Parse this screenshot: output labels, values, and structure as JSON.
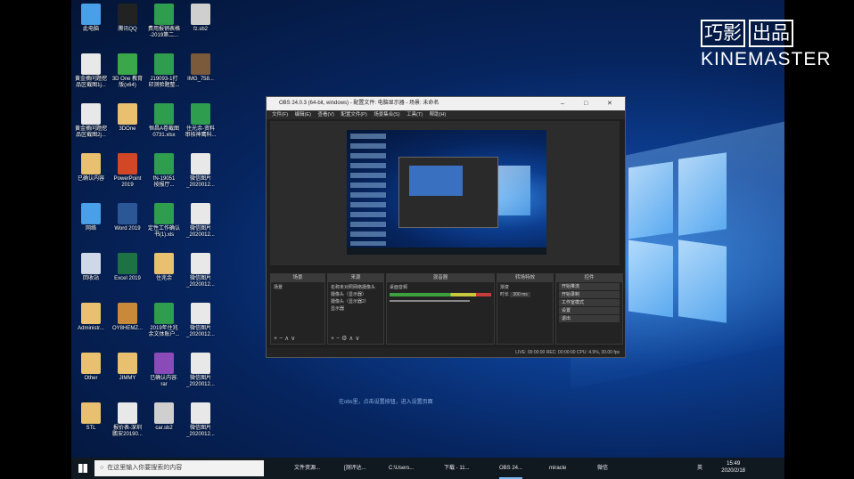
{
  "desktop": {
    "icons": [
      {
        "label": "此电脑",
        "color": "#4aa0e8"
      },
      {
        "label": "腾讯QQ",
        "color": "#222222"
      },
      {
        "label": "费用报销表格\n-2019第二...",
        "color": "#2e9d4e"
      },
      {
        "label": "fz.sb2",
        "color": "#cfcfcf"
      },
      {
        "label": "黄金摘问题挖\n品区截图1j...",
        "color": "#e8e8e8"
      },
      {
        "label": "3D One 教育\n版(x64)",
        "color": "#3aa84a"
      },
      {
        "label": "J19093-1打\n印测验题整...",
        "color": "#2e9d4e"
      },
      {
        "label": "IMG_758...",
        "color": "#7a5a3a"
      },
      {
        "label": "黄金摘问题挖\n品区截图2j...",
        "color": "#e8e8e8"
      },
      {
        "label": "3DOne",
        "color": "#e8c070"
      },
      {
        "label": "恒昌A卷截图\n0731.xlsx",
        "color": "#2e9d4e"
      },
      {
        "label": "住光余-资料\n审核神鹰科...",
        "color": "#2e9d4e"
      },
      {
        "label": "已确认内容",
        "color": "#e8c070"
      },
      {
        "label": "PowerPoint\n2019",
        "color": "#d24726"
      },
      {
        "label": "fN-19051\n按报厅...",
        "color": "#2e9d4e"
      },
      {
        "label": "微信图片\n_2020012...",
        "color": "#e8e8e8"
      },
      {
        "label": "网络",
        "color": "#4aa0e8"
      },
      {
        "label": "Word 2019",
        "color": "#2b5797"
      },
      {
        "label": "定性工作确认\n书(1).xls",
        "color": "#2e9d4e"
      },
      {
        "label": "微信图片\n_2020012...",
        "color": "#e8e8e8"
      },
      {
        "label": "回收站",
        "color": "#cfd8e8"
      },
      {
        "label": "Excel 2019",
        "color": "#1e7145"
      },
      {
        "label": "住兆余",
        "color": "#e8c070"
      },
      {
        "label": "微信图片\n_2020012...",
        "color": "#e8e8e8"
      },
      {
        "label": "Administr...",
        "color": "#e8c070"
      },
      {
        "label": "OY8HEMZ...",
        "color": "#c88a3a"
      },
      {
        "label": "2019年住兆\n余文体账户...",
        "color": "#2e9d4e"
      },
      {
        "label": "微信图片\n_2020012...",
        "color": "#e8e8e8"
      },
      {
        "label": "Other",
        "color": "#e8c070"
      },
      {
        "label": "JIMMY",
        "color": "#e8c070"
      },
      {
        "label": "已确认内容.\nrar",
        "color": "#8a4ab8"
      },
      {
        "label": "微信图片\n_2020012...",
        "color": "#e8e8e8"
      },
      {
        "label": "STL",
        "color": "#e8c070"
      },
      {
        "label": "报价表-深圳\n鹏安20190...",
        "color": "#e8e8e8"
      },
      {
        "label": "car.sb2",
        "color": "#cfcfcf"
      },
      {
        "label": "微信图片\n_2020012...",
        "color": "#e8e8e8"
      }
    ]
  },
  "obs": {
    "title": "OBS 24.0.3 (64-bit, windows) - 配置文件: 电脑显示器 - 场景: 未命名",
    "menu": [
      "文件(F)",
      "编辑(E)",
      "查看(V)",
      "配置文件(P)",
      "场景集合(S)",
      "工具(T)",
      "帮助(H)"
    ],
    "docks": {
      "scenes": {
        "header": "场景",
        "items": [
          "场景"
        ]
      },
      "sources": {
        "header": "来源",
        "items": [
          "名称未对照网络摄像头",
          "摄像头（显示器）",
          "摄像头（显示器2）",
          "显示器"
        ]
      },
      "mixer": {
        "header": "混音器",
        "items": [
          "桌面音频"
        ]
      },
      "transitions": {
        "header": "转场特效",
        "mode": "渐变",
        "duration_label": "时长",
        "duration_value": "300 ms"
      },
      "controls": {
        "header": "控件",
        "buttons": [
          "开始推流",
          "开始录制",
          "工作室模式",
          "设置",
          "退出"
        ]
      }
    },
    "status": "LIVE: 00:00:00     REC: 00:00:00     CPU: 4.9%, 30.00 fps"
  },
  "caption": "在obs里，点击设置按钮，进入设置页面",
  "taskbar": {
    "search_placeholder": "在这里输入你要搜索的内容",
    "items": [
      "文件资源...",
      "[测评达...",
      "C:\\Users...",
      "下载 - 11...",
      "OBS 24...",
      "miracle",
      "微信"
    ],
    "time": "15:49",
    "date": "2020/2/18",
    "ime": "英"
  },
  "watermark": {
    "top": [
      "巧影",
      "出品"
    ],
    "bottom": "KINEMASTER"
  }
}
